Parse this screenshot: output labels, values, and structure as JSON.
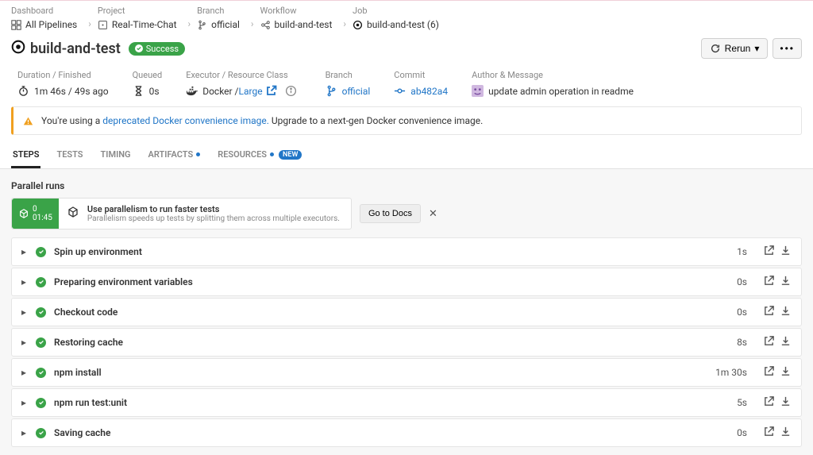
{
  "breadcrumbs": [
    {
      "group": "Dashboard",
      "label": "All Pipelines"
    },
    {
      "group": "Project",
      "label": "Real-Time-Chat"
    },
    {
      "group": "Branch",
      "label": "official"
    },
    {
      "group": "Workflow",
      "label": "build-and-test"
    },
    {
      "group": "Job",
      "label": "build-and-test (6)"
    }
  ],
  "job": {
    "title": "build-and-test",
    "status": "Success"
  },
  "actions": {
    "rerun": "Rerun"
  },
  "meta": {
    "duration_label": "Duration / Finished",
    "duration": "1m 46s / 49s ago",
    "queued_label": "Queued",
    "queued": "0s",
    "executor_label": "Executor / Resource Class",
    "executor_prefix": "Docker / ",
    "executor_link": "Large",
    "branch_label": "Branch",
    "branch": "official",
    "commit_label": "Commit",
    "commit": "ab482a4",
    "author_label": "Author & Message",
    "author_msg": "update admin operation in readme"
  },
  "banner": {
    "prefix": "You're using a ",
    "link": "deprecated Docker convenience image.",
    "suffix": " Upgrade to a next-gen Docker convenience image."
  },
  "tabs": {
    "steps": "STEPS",
    "tests": "TESTS",
    "timing": "TIMING",
    "artifacts": "ARTIFACTS",
    "resources": "RESOURCES",
    "new": "NEW"
  },
  "parallel": {
    "section": "Parallel runs",
    "badge_count": "0",
    "badge_time": "01:45",
    "title": "Use parallelism to run faster tests",
    "sub": "Parallelism speeds up tests by splitting them across multiple executors.",
    "docs": "Go to Docs"
  },
  "steps": [
    {
      "name": "Spin up environment",
      "dur": "1s"
    },
    {
      "name": "Preparing environment variables",
      "dur": "0s"
    },
    {
      "name": "Checkout code",
      "dur": "0s"
    },
    {
      "name": "Restoring cache",
      "dur": "8s"
    },
    {
      "name": "npm install",
      "dur": "1m 30s"
    },
    {
      "name": "npm run test:unit",
      "dur": "5s"
    },
    {
      "name": "Saving cache",
      "dur": "0s"
    }
  ]
}
